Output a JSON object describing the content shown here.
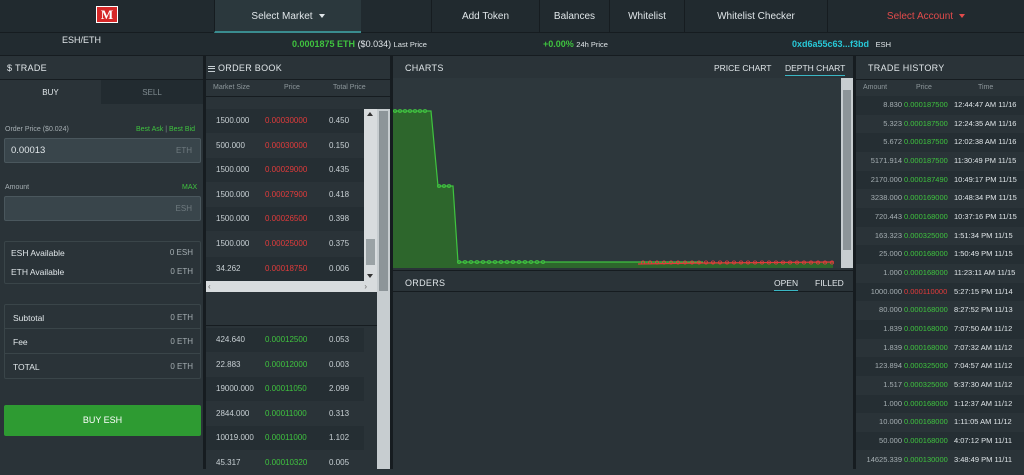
{
  "nav": {
    "select_market": "Select Market",
    "add_token": "Add Token",
    "balances": "Balances",
    "whitelist": "Whitelist",
    "whitelist_checker": "Whitelist Checker",
    "select_account": "Select Account",
    "logo_text": "M"
  },
  "ticker": {
    "pair": "ESH/ETH",
    "last_price": "0.0001875 ETH",
    "last_price_usd": "($0.034)",
    "last_price_label": "Last Price",
    "change": "+0.00%",
    "change_label": "24h Price",
    "address": "0xd6a55c63...f3bd",
    "token": "ESH"
  },
  "trade": {
    "title": "$ TRADE",
    "buy_tab": "BUY",
    "sell_tab": "SELL",
    "order_price_label": "Order Price ($0.024)",
    "best_ask": "Best Ask",
    "divider": "|",
    "best_bid": "Best Bid",
    "price_value": "0.00013",
    "price_unit": "ETH",
    "amount_label": "Amount",
    "max": "MAX",
    "amount_unit": "ESH",
    "esh_available_label": "ESH Available",
    "esh_available": "0 ESH",
    "eth_available_label": "ETH Available",
    "eth_available": "0 ETH",
    "subtotal_label": "Subtotal",
    "subtotal": "0 ETH",
    "fee_label": "Fee",
    "fee": "0 ETH",
    "total_label": "TOTAL",
    "total": "0 ETH",
    "buy_button": "BUY ESH"
  },
  "orderbook": {
    "title": "ORDER BOOK",
    "headers": [
      "Market Size",
      "Price",
      "Total Price"
    ],
    "asks": [
      [
        "1500.000",
        "0.00030000",
        "0.450"
      ],
      [
        "500.000",
        "0.00030000",
        "0.150"
      ],
      [
        "1500.000",
        "0.00029000",
        "0.435"
      ],
      [
        "1500.000",
        "0.00027900",
        "0.418"
      ],
      [
        "1500.000",
        "0.00026500",
        "0.398"
      ],
      [
        "1500.000",
        "0.00025000",
        "0.375"
      ],
      [
        "34.262",
        "0.00018750",
        "0.006"
      ]
    ],
    "bids": [
      [
        "424.640",
        "0.00012500",
        "0.053"
      ],
      [
        "22.883",
        "0.00012000",
        "0.003"
      ],
      [
        "19000.000",
        "0.00011050",
        "2.099"
      ],
      [
        "2844.000",
        "0.00011000",
        "0.313"
      ],
      [
        "10019.000",
        "0.00011000",
        "1.102"
      ],
      [
        "45.317",
        "0.00010320",
        "0.005"
      ]
    ]
  },
  "charts": {
    "title": "CHARTS",
    "price_chart": "PRICE CHART",
    "depth_chart": "DEPTH CHART"
  },
  "orders": {
    "title": "ORDERS",
    "open": "OPEN",
    "filled": "FILLED"
  },
  "history": {
    "title": "TRADE HISTORY",
    "headers": [
      "Amount",
      "Price",
      "Time"
    ],
    "rows": [
      [
        "8.830",
        "0.000187500",
        "12:44:47 AM 11/16",
        "buy"
      ],
      [
        "5.323",
        "0.000187500",
        "12:24:35 AM 11/16",
        "buy"
      ],
      [
        "5.672",
        "0.000187500",
        "12:02:38 AM 11/16",
        "buy"
      ],
      [
        "5171.914",
        "0.000187500",
        "11:30:49 PM 11/15",
        "buy"
      ],
      [
        "2170.000",
        "0.000187490",
        "10:49:17 PM 11/15",
        "buy"
      ],
      [
        "3238.000",
        "0.000169000",
        "10:48:34 PM 11/15",
        "buy"
      ],
      [
        "720.443",
        "0.000168000",
        "10:37:16 PM 11/15",
        "buy"
      ],
      [
        "163.323",
        "0.000325000",
        "1:51:34 PM 11/15",
        "buy"
      ],
      [
        "25.000",
        "0.000168000",
        "1:50:49 PM 11/15",
        "buy"
      ],
      [
        "1.000",
        "0.000168000",
        "11:23:11 AM 11/15",
        "buy"
      ],
      [
        "1000.000",
        "0.000110000",
        "5:27:15 PM 11/14",
        "sell"
      ],
      [
        "80.000",
        "0.000168000",
        "8:27:52 PM 11/13",
        "buy"
      ],
      [
        "1.839",
        "0.000168000",
        "7:07:50 AM 11/12",
        "buy"
      ],
      [
        "1.839",
        "0.000168000",
        "7:07:32 AM 11/12",
        "buy"
      ],
      [
        "123.894",
        "0.000325000",
        "7:04:57 AM 11/12",
        "buy"
      ],
      [
        "1.517",
        "0.000325000",
        "5:37:30 AM 11/12",
        "buy"
      ],
      [
        "1.000",
        "0.000168000",
        "1:12:37 AM 11/12",
        "buy"
      ],
      [
        "10.000",
        "0.000168000",
        "1:11:05 AM 11/12",
        "buy"
      ],
      [
        "50.000",
        "0.000168000",
        "4:07:12 PM 11/11",
        "buy"
      ],
      [
        "14625.339",
        "0.000130000",
        "3:48:49 PM 11/11",
        "buy"
      ]
    ]
  },
  "colors": {
    "green": "#3fc33f",
    "red": "#e23b3b",
    "cyan": "#28c9d8",
    "buy_button": "#2e9b32",
    "depth_bid": "#2d6b2a",
    "depth_ask": "#6b2a2a"
  }
}
